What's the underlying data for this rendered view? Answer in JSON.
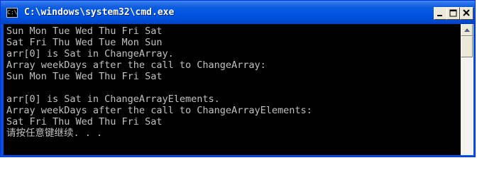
{
  "window": {
    "title": "C:\\windows\\system32\\cmd.exe",
    "icon": "console-icon",
    "buttons": [
      "minimize-icon",
      "maximize-icon",
      "close-icon"
    ]
  },
  "console": {
    "lines": [
      "Sun Mon Tue Wed Thu Fri Sat",
      "Sat Fri Thu Wed Tue Mon Sun",
      "arr[0] is Sat in ChangeArray.",
      "Array weekDays after the call to ChangeArray:",
      "Sun Mon Tue Wed Thu Fri Sat",
      "",
      "arr[0] is Sat in ChangeArrayElements.",
      "Array weekDays after the call to ChangeArrayElements:",
      "Sat Fri Thu Wed Thu Fri Sat",
      "请按任意键继续. . ."
    ]
  },
  "colors": {
    "titlebar": "#0054e3",
    "console_bg": "#000000",
    "console_fg": "#c0c0c0"
  }
}
